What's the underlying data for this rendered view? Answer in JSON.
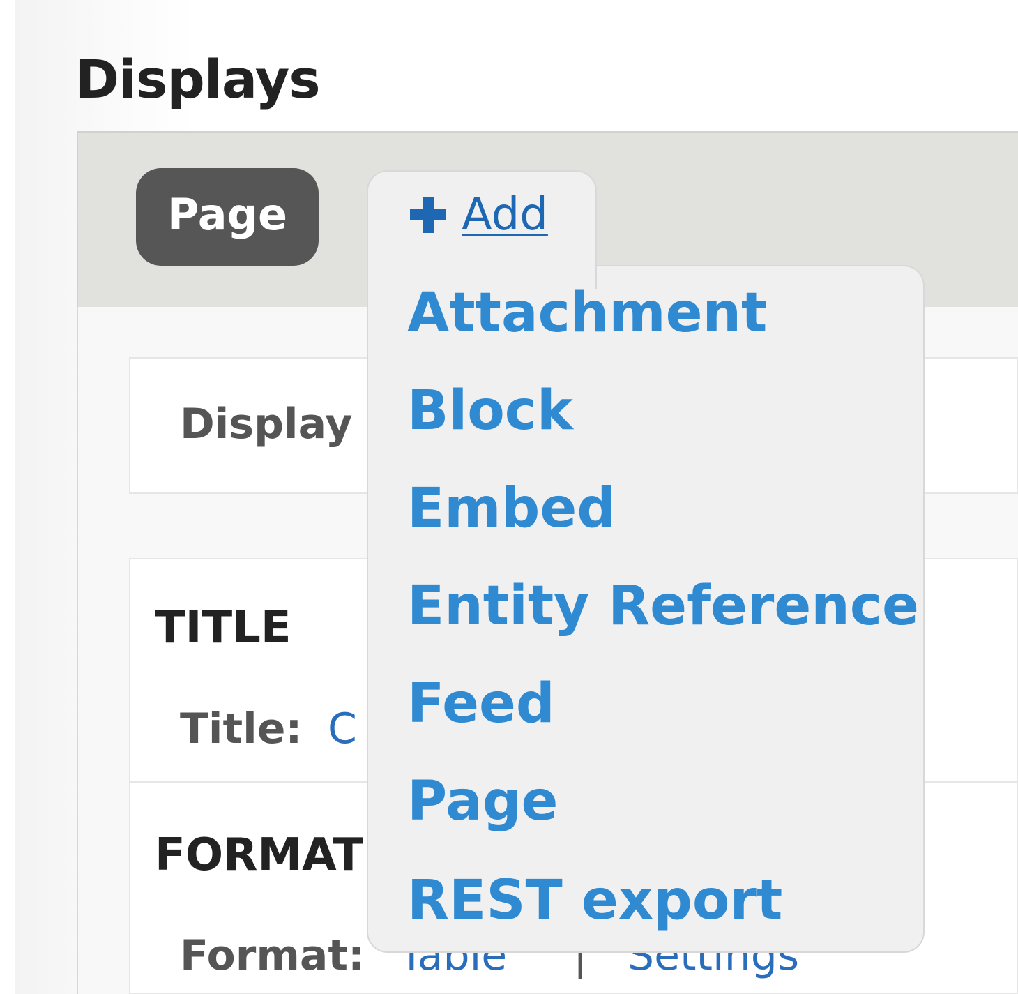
{
  "page": {
    "heading": "Displays"
  },
  "tabs": {
    "active_tab": "Page",
    "add_label": "Add"
  },
  "add_menu": {
    "items": [
      "Attachment",
      "Block",
      "Embed",
      "Entity Reference",
      "Feed",
      "Page",
      "REST export"
    ]
  },
  "display_panel": {
    "display_name_label": "Display"
  },
  "settings_panel": {
    "title_section": "TITLE",
    "title_label": "Title:",
    "title_value": "C",
    "format_section": "FORMAT",
    "format_label": "Format:",
    "format_value": "Table",
    "separator": "|",
    "settings_link": "Settings"
  },
  "colors": {
    "accent_link": "#2f8ad2",
    "add_link": "#1e68b3",
    "active_tab_bg": "#565656",
    "tabs_bar_bg": "#e1e1dd",
    "dropdown_bg": "#f0f0f0"
  },
  "icons": {
    "add": "plus-icon"
  }
}
